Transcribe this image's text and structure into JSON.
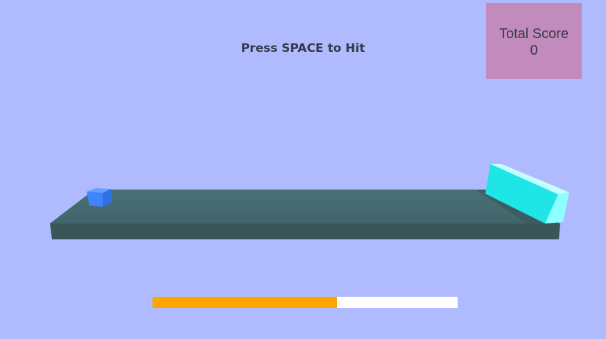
{
  "hud": {
    "hint_text": "Press SPACE to Hit",
    "score_label": "Total Score",
    "score_value": "0"
  },
  "power": {
    "fraction": 0.605,
    "fill_color": "#ffa500",
    "track_color": "#ffffff"
  },
  "scene": {
    "background_color": "#afbbfe",
    "table_top_color": "#466a72",
    "table_front_color": "#3b5656",
    "puck_color": "#3f84fc",
    "bumper_color": "#1ee6e6"
  }
}
